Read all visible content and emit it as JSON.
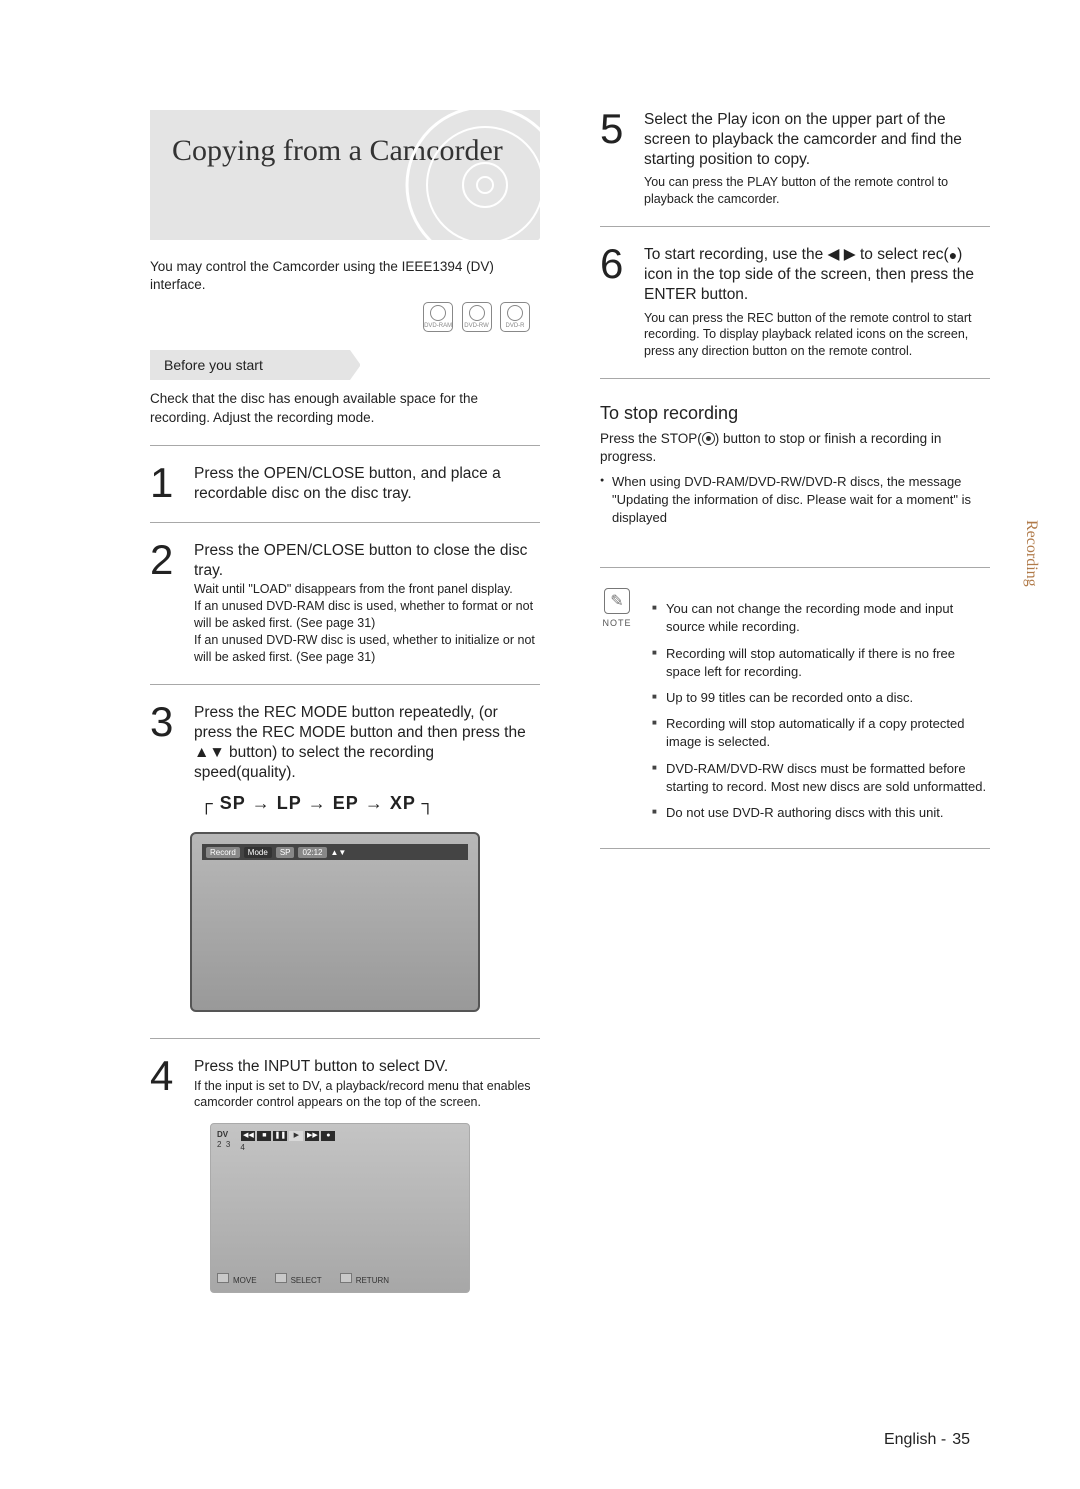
{
  "sideTab": "Recording",
  "footer": {
    "lang": "English -",
    "page": "35"
  },
  "left": {
    "title": "Copying from a Camcorder",
    "intro": "You may control the Camcorder using the IEEE1394 (DV) interface.",
    "discIcons": [
      "DVD-RAM",
      "DVD-RW",
      "DVD-R"
    ],
    "beforeLabel": "Before you start",
    "beforeText": "Check that the disc has enough available space for the recording. Adjust the recording mode.",
    "step1": {
      "num": "1",
      "lead": "Press the OPEN/CLOSE button, and place a recordable disc on the disc tray."
    },
    "step2": {
      "num": "2",
      "lead": "Press the OPEN/CLOSE button to close the disc tray.",
      "lines": [
        "Wait until \"LOAD\" disappears from the front panel display.",
        "If an unused DVD-RAM disc is used, whether to format or not will be asked first. (See page 31)",
        "If an unused DVD-RW disc is used, whether to initialize or not will be asked first. (See page 31)"
      ]
    },
    "step3": {
      "num": "3",
      "lead": "Press the REC MODE button repeatedly, (or press the REC MODE button and then press the ▲▼ button) to select the recording speed(quality).",
      "seqParts": [
        "SP",
        "LP",
        "EP",
        "XP"
      ],
      "osd": {
        "rec": "Record",
        "mode": "Mode",
        "q": "SP",
        "t": "02:12"
      }
    },
    "step4": {
      "num": "4",
      "lead": "Press the INPUT button to select DV.",
      "sub": "If the input is set to DV, a playback/record menu that enables camcorder control appears on the top of the screen.",
      "osd": {
        "dv": "DV",
        "l2": "2",
        "l3": "3",
        "l4": "4",
        "bMove": "MOVE",
        "bSel": "SELECT",
        "bRet": "RETURN"
      }
    }
  },
  "right": {
    "step5": {
      "num": "5",
      "lead": "Select the Play icon on the upper part of the screen to playback the camcorder and find the starting position to copy.",
      "sub": "You can press the PLAY button of the remote control to playback the camcorder."
    },
    "step6": {
      "num": "6",
      "lead_a": "To start recording, use the ◀ ▶ to select rec(",
      "lead_b": ") icon in the top side of the screen, then press the ENTER button.",
      "sub": "You can press the REC button of the remote control to start recording. To display playback related icons on the screen, press any direction button on the remote control."
    },
    "stop": {
      "heading": "To stop recording",
      "p1": "Press the STOP(    ) button to stop or finish a recording in progress.",
      "bullet": "When using DVD-RAM/DVD-RW/DVD-R discs, the message \"Updating the information of disc. Please wait for a moment\" is displayed"
    },
    "noteLabel": "NOTE",
    "notes": [
      "You can not change the recording mode and input source while recording.",
      "Recording will stop automatically if there is no free space left for recording.",
      "Up to 99 titles can be recorded onto a disc.",
      "Recording will stop automatically if a copy protected image is selected.",
      "DVD-RAM/DVD-RW discs must be formatted before starting to record. Most new discs are sold unformatted.",
      "Do not use DVD-R authoring discs with this unit."
    ]
  }
}
